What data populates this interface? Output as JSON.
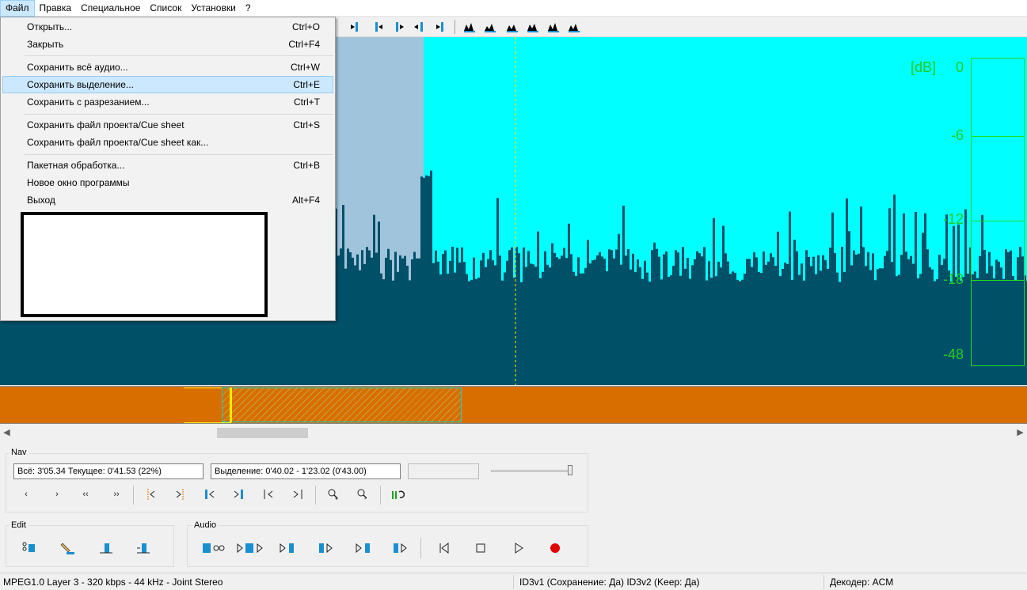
{
  "menubar": [
    "Файл",
    "Правка",
    "Специальное",
    "Список",
    "Установки",
    "?"
  ],
  "file_menu": [
    {
      "label": "Открыть...",
      "shortcut": "Ctrl+O"
    },
    {
      "label": "Закрыть",
      "shortcut": "Ctrl+F4"
    },
    {
      "label": "Сохранить всё аудио...",
      "shortcut": "Ctrl+W"
    },
    {
      "label": "Сохранить выделение...",
      "shortcut": "Ctrl+E"
    },
    {
      "label": "Сохранить с разрезанием...",
      "shortcut": "Ctrl+T"
    },
    {
      "label": "Сохранить файл проекта/Cue sheet",
      "shortcut": "Ctrl+S"
    },
    {
      "label": "Сохранить файл проекта/Cue sheet как...",
      "shortcut": ""
    },
    {
      "label": "Пакетная обработка...",
      "shortcut": "Ctrl+B"
    },
    {
      "label": "Новое окно программы",
      "shortcut": ""
    },
    {
      "label": "Выход",
      "shortcut": "Alt+F4"
    }
  ],
  "meter": {
    "unit": "[dB]",
    "ticks": [
      "0",
      "-6",
      "-12",
      "-18",
      "-48"
    ]
  },
  "nav": {
    "title": "Nav",
    "position": "Всё: 3'05.34   Текущее: 0'41.53   (22%)",
    "selection": "Выделение: 0'40.02 - 1'23.02 (0'43.00)"
  },
  "edit": {
    "title": "Edit"
  },
  "audio": {
    "title": "Audio"
  },
  "status": {
    "format": "MPEG1.0 Layer 3 - 320 kbps - 44 kHz - Joint Stereo",
    "id3": "ID3v1 (Сохранение: Да)   ID3v2 (Keep: Да)",
    "decoder": "Декодер: ACM"
  },
  "colors": {
    "wave_bg": "#00ffff",
    "wave_fill": "#005068",
    "selection": "#a0c4dc",
    "overview": "#d86e00",
    "meter": "#22cc22"
  }
}
